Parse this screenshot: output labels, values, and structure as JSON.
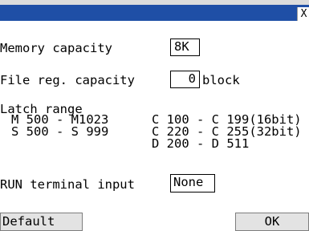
{
  "window": {
    "close_glyph": "X"
  },
  "memory": {
    "label": "Memory capacity",
    "value": "8K"
  },
  "file_reg": {
    "label": "File reg. capacity",
    "value": "0",
    "unit": "block"
  },
  "latch": {
    "heading": "Latch range",
    "col1": [
      "M 500 - M1023",
      "S 500 - S 999"
    ],
    "col2": [
      "C 100 - C 199(16bit)",
      "C 220 - C 255(32bit)",
      "D 200 - D 511"
    ]
  },
  "run_terminal": {
    "label": "RUN terminal input",
    "value": "None"
  },
  "buttons": {
    "default_label": "Default",
    "ok_label": "OK"
  }
}
